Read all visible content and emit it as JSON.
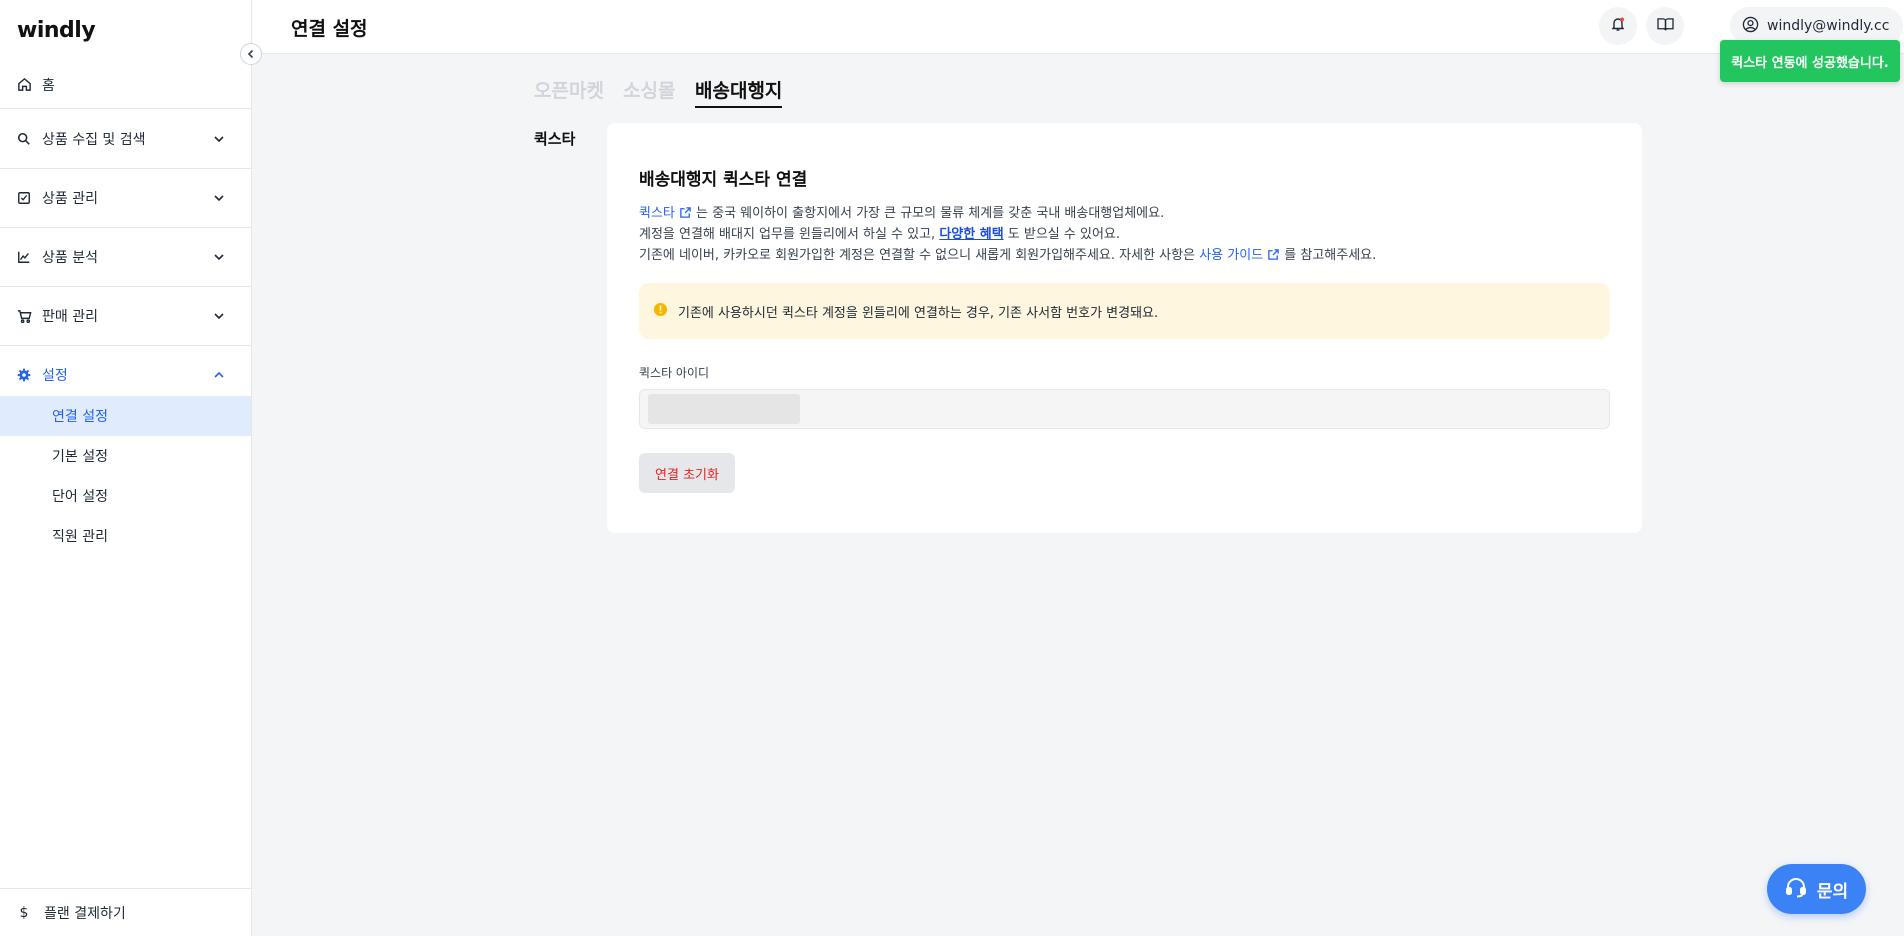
{
  "app": {
    "logo": "windly"
  },
  "sidebar": {
    "home": "홈",
    "items": [
      {
        "label": "상품 수집 및 검색"
      },
      {
        "label": "상품 관리"
      },
      {
        "label": "상품 분석"
      },
      {
        "label": "판매 관리"
      },
      {
        "label": "설정"
      }
    ],
    "settings_sub": [
      {
        "label": "연결 설정"
      },
      {
        "label": "기본 설정"
      },
      {
        "label": "단어 설정"
      },
      {
        "label": "직원 관리"
      }
    ],
    "plan": "플랜 결제하기"
  },
  "header": {
    "title": "연결 설정",
    "user_email": "windly@windly.cc"
  },
  "tabs": [
    {
      "label": "오픈마켓"
    },
    {
      "label": "소싱몰"
    },
    {
      "label": "배송대행지"
    }
  ],
  "section_label": "퀵스타",
  "card": {
    "title": "배송대행지 퀵스타 연결",
    "line1_link": "퀵스타",
    "line1_text": "는 중국 웨이하이 출항지에서 가장 큰 규모의 물류 체계를 갖춘 국내 배송대행업체에요.",
    "line2_pre": "계정을 연결해 배대지 업무를 윈들리에서 하실 수 있고,",
    "line2_link": "다양한 혜택",
    "line2_post": "도 받으실 수 있어요.",
    "line3_pre": "기존에 네이버, 카카오로 회원가입한 계정은 연결할 수 없으니 새롭게 회원가입해주세요. 자세한 사항은",
    "line3_link": "사용 가이드",
    "line3_post": "를 참고해주세요.",
    "alert": "기존에 사용하시던 퀵스타 계정을 윈들리에 연결하는 경우, 기존 사서함 번호가 변경돼요.",
    "field_label": "퀵스타 아이디",
    "reset_button": "연결 초기화"
  },
  "toast": "퀵스타 연동에 성공했습니다.",
  "inquiry": "문의",
  "colors": {
    "accent": "#2563eb",
    "success": "#22c55e",
    "warning_bg": "#fef6de",
    "danger": "#dc2626"
  }
}
